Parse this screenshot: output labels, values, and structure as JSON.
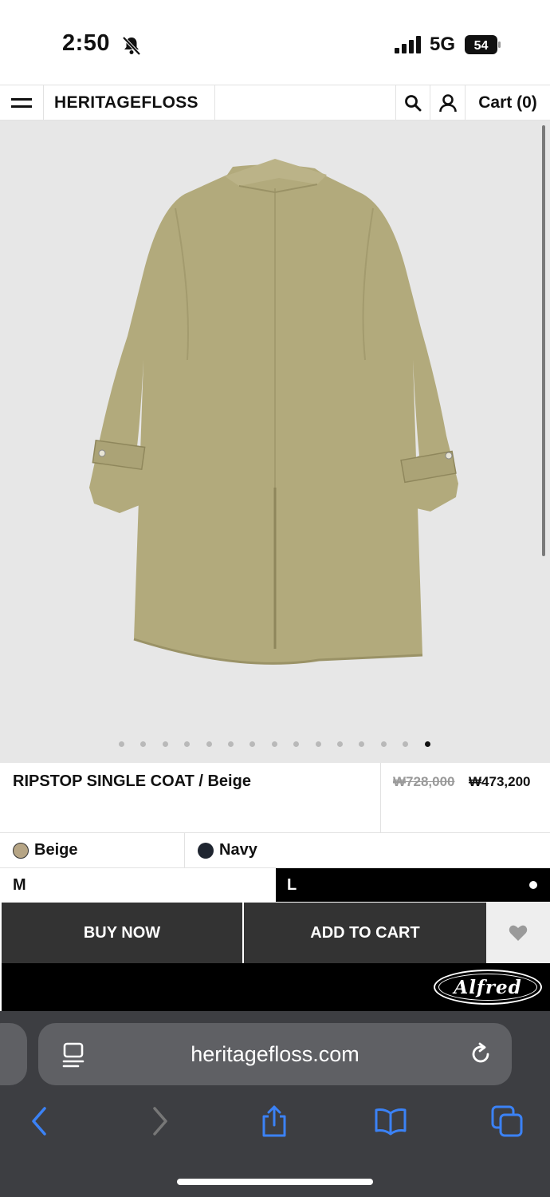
{
  "status_bar": {
    "time": "2:50",
    "network": "5G",
    "battery": "54",
    "icons": [
      "bell-slash-icon",
      "signal-icon",
      "battery-icon"
    ]
  },
  "header": {
    "brand": "HERITAGEFLOSS",
    "cart_label": "Cart (0)",
    "icons": [
      "menu-icon",
      "search-icon",
      "account-icon"
    ]
  },
  "gallery": {
    "slide_count": 15,
    "active_index": 14
  },
  "product": {
    "title": "RIPSTOP SINGLE COAT / Beige",
    "price_original": "₩728,000",
    "price_sale": "₩473,200"
  },
  "colors": [
    {
      "label": "Beige",
      "swatch": "#b6a585"
    },
    {
      "label": "Navy",
      "swatch": "#1f2530"
    }
  ],
  "sizes": [
    {
      "label": "M",
      "selected": false
    },
    {
      "label": "L",
      "selected": true
    }
  ],
  "actions": {
    "buy_now": "BUY NOW",
    "add_to_cart": "ADD TO CART",
    "wishlist_icon": "heart-icon"
  },
  "banner": {
    "logo_text": "Alfred"
  },
  "browser": {
    "url": "heritagefloss.com",
    "icons": [
      "reader-icon",
      "reload-icon",
      "back-icon",
      "forward-icon",
      "share-icon",
      "bookmarks-icon",
      "tabs-icon"
    ]
  },
  "colors_theme": {
    "button_dark": "#333333",
    "safari_bar": "#3d3e42",
    "accent_blue": "#3b82f6"
  }
}
